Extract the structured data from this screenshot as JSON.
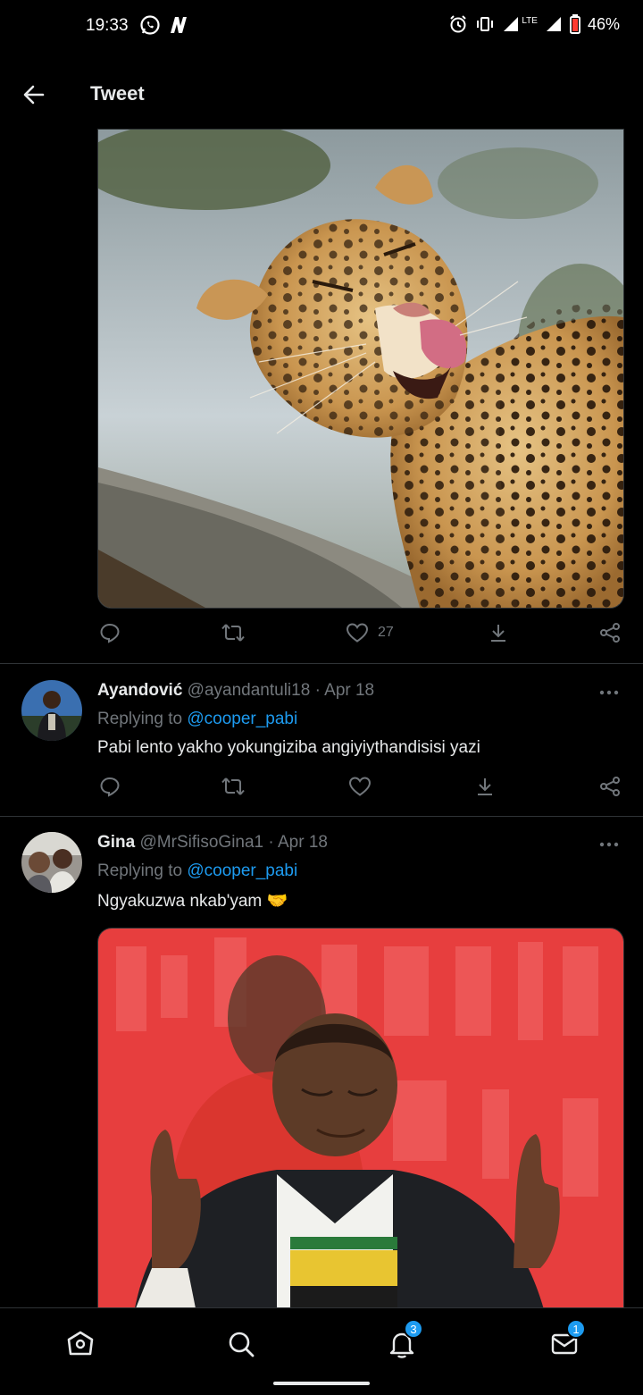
{
  "status_bar": {
    "time": "19:33",
    "battery": "46%",
    "network": "LTE",
    "icons": [
      "whatsapp-icon",
      "n-app-icon",
      "alarm-icon",
      "vibrate-icon",
      "signal-icon",
      "signal-icon",
      "battery-icon"
    ]
  },
  "header": {
    "title": "Tweet"
  },
  "main_tweet": {
    "actions": {
      "like_count": "27"
    }
  },
  "replies": [
    {
      "name": "Ayandović",
      "handle": "@ayandantuli18",
      "date": "Apr 18",
      "replying_prefix": "Replying to",
      "replying_to": "@cooper_pabi",
      "text": "Pabi lento yakho yokungiziba angiyiythandisisi yazi"
    },
    {
      "name": "Gina",
      "handle": "@MrSifisoGina1",
      "date": "Apr 18",
      "replying_prefix": "Replying to",
      "replying_to": "@cooper_pabi",
      "text": "Ngyakuzwa nkab'yam 🤝"
    }
  ],
  "bottom_nav": {
    "notifications_badge": "3",
    "messages_badge": "1"
  },
  "colors": {
    "background": "#000000",
    "text": "#e7e9ea",
    "secondary": "#71767b",
    "accent": "#1d9bf0",
    "divider": "#2f3336"
  }
}
